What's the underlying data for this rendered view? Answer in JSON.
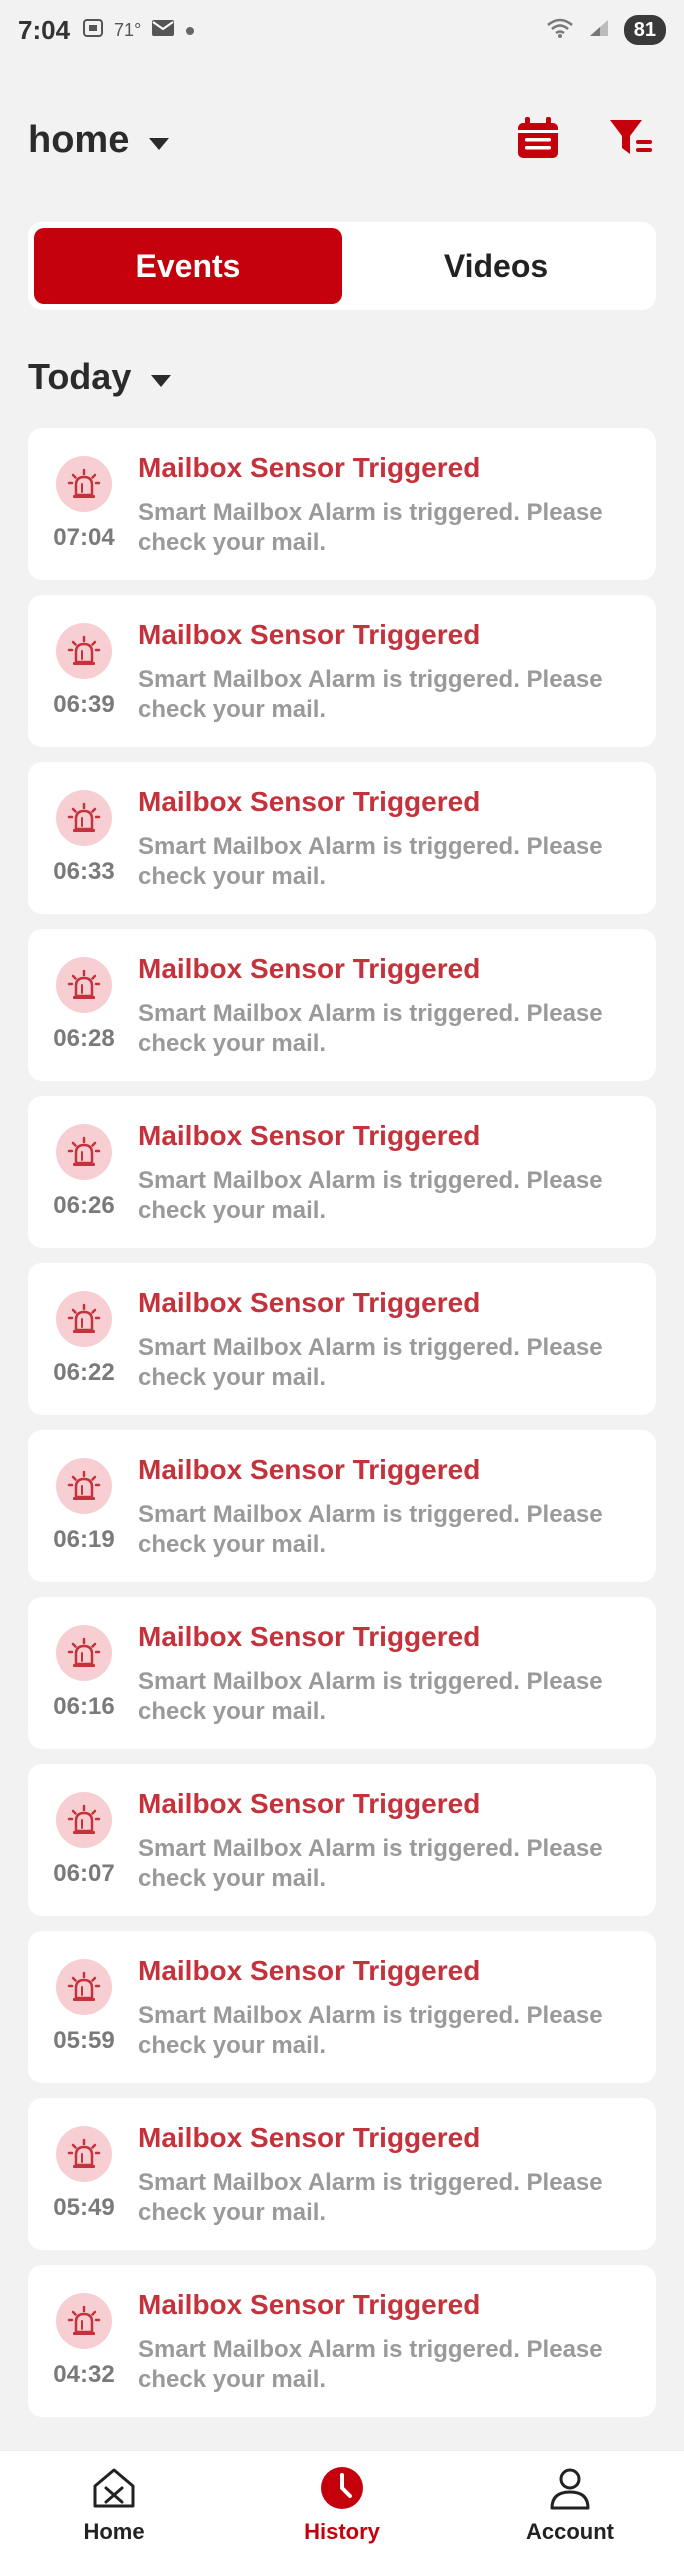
{
  "status_bar": {
    "time": "7:04",
    "temperature": "71°",
    "battery": "81"
  },
  "header": {
    "title": "home",
    "calendar_icon": "calendar-icon",
    "filter_icon": "filter-icon"
  },
  "tabs": [
    {
      "label": "Events",
      "active": true
    },
    {
      "label": "Videos",
      "active": false
    }
  ],
  "section": {
    "title": "Today"
  },
  "events": [
    {
      "time": "07:04",
      "title": "Mailbox Sensor Triggered",
      "description": "Smart Mailbox Alarm is triggered. Please check your mail."
    },
    {
      "time": "06:39",
      "title": "Mailbox Sensor Triggered",
      "description": "Smart Mailbox Alarm is triggered. Please check your mail."
    },
    {
      "time": "06:33",
      "title": "Mailbox Sensor Triggered",
      "description": "Smart Mailbox Alarm is triggered. Please check your mail."
    },
    {
      "time": "06:28",
      "title": "Mailbox Sensor Triggered",
      "description": "Smart Mailbox Alarm is triggered. Please check your mail."
    },
    {
      "time": "06:26",
      "title": "Mailbox Sensor Triggered",
      "description": "Smart Mailbox Alarm is triggered. Please check your mail."
    },
    {
      "time": "06:22",
      "title": "Mailbox Sensor Triggered",
      "description": "Smart Mailbox Alarm is triggered. Please check your mail."
    },
    {
      "time": "06:19",
      "title": "Mailbox Sensor Triggered",
      "description": "Smart Mailbox Alarm is triggered. Please check your mail."
    },
    {
      "time": "06:16",
      "title": "Mailbox Sensor Triggered",
      "description": "Smart Mailbox Alarm is triggered. Please check your mail."
    },
    {
      "time": "06:07",
      "title": "Mailbox Sensor Triggered",
      "description": "Smart Mailbox Alarm is triggered. Please check your mail."
    },
    {
      "time": "05:59",
      "title": "Mailbox Sensor Triggered",
      "description": "Smart Mailbox Alarm is triggered. Please check your mail."
    },
    {
      "time": "05:49",
      "title": "Mailbox Sensor Triggered",
      "description": "Smart Mailbox Alarm is triggered. Please check your mail."
    },
    {
      "time": "04:32",
      "title": "Mailbox Sensor Triggered",
      "description": "Smart Mailbox Alarm is triggered. Please check your mail."
    }
  ],
  "bottom_nav": [
    {
      "label": "Home",
      "icon": "home-icon",
      "active": false
    },
    {
      "label": "History",
      "icon": "history-icon",
      "active": true
    },
    {
      "label": "Account",
      "icon": "account-icon",
      "active": false
    }
  ],
  "colors": {
    "accent": "#c4000c",
    "event_title": "#c4323c",
    "badge_bg": "#f7cfd3"
  }
}
